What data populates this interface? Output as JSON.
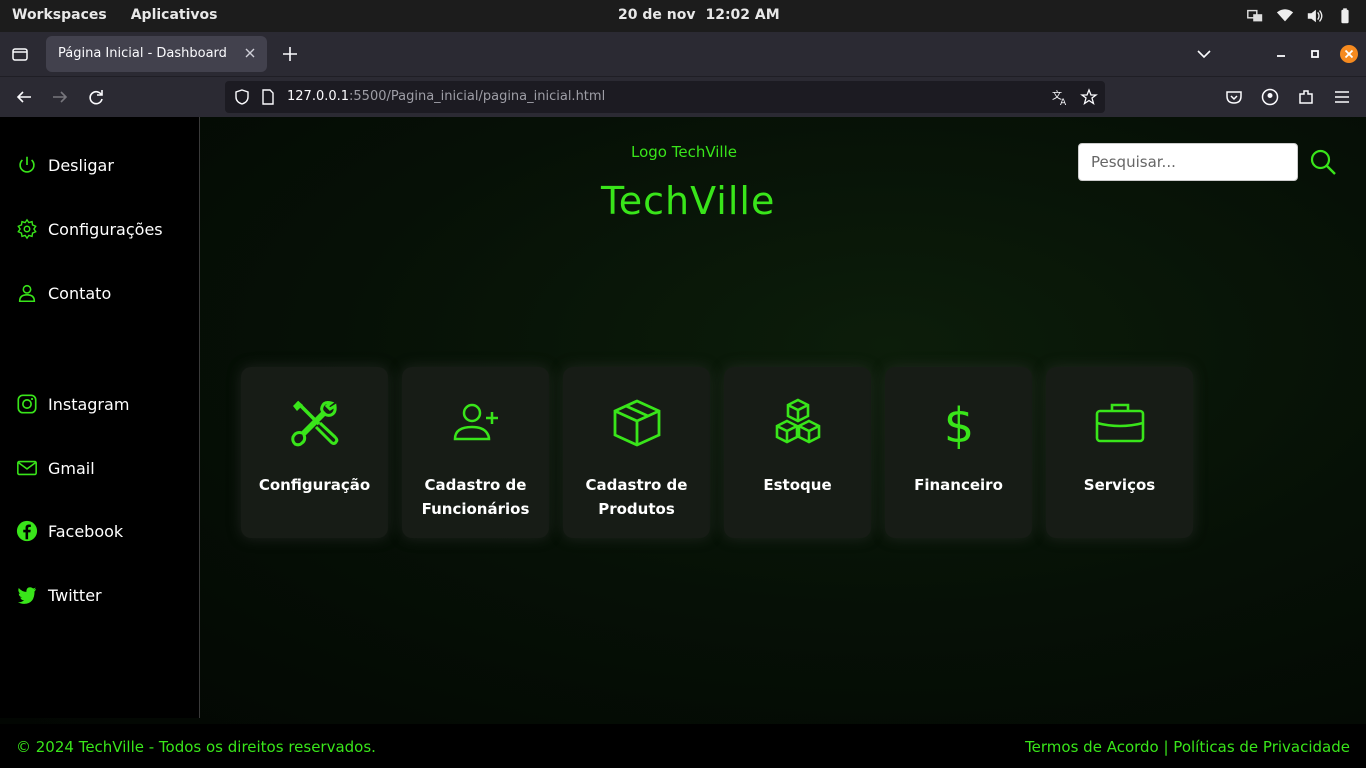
{
  "os": {
    "workspaces": "Workspaces",
    "apps": "Aplicativos",
    "date": "20 de nov",
    "time": "12:02 AM"
  },
  "browser": {
    "tab_title": "Página Inicial - Dashboard",
    "url_host": "127.0.0.1",
    "url_rest": ":5500/Pagina_inicial/pagina_inicial.html"
  },
  "sidebar": {
    "items": [
      {
        "label": "Desligar",
        "icon": "power-icon"
      },
      {
        "label": "Configurações",
        "icon": "gear-icon"
      },
      {
        "label": "Contato",
        "icon": "user-icon"
      },
      {
        "label": "Instagram",
        "icon": "instagram-icon"
      },
      {
        "label": "Gmail",
        "icon": "mail-icon"
      },
      {
        "label": "Facebook",
        "icon": "facebook-icon"
      },
      {
        "label": "Twitter",
        "icon": "twitter-icon"
      }
    ]
  },
  "header": {
    "logo_alt": "Logo TechVille",
    "brand": "TechVille",
    "search_placeholder": "Pesquisar..."
  },
  "cards": [
    {
      "label": "Configuração",
      "icon": "tools-icon"
    },
    {
      "label": "Cadastro de Funcionários",
      "icon": "add-user-icon"
    },
    {
      "label": "Cadastro de Produtos",
      "icon": "box-icon"
    },
    {
      "label": "Estoque",
      "icon": "boxes-icon"
    },
    {
      "label": "Financeiro",
      "icon": "dollar-icon"
    },
    {
      "label": "Serviços",
      "icon": "briefcase-icon"
    }
  ],
  "footer": {
    "copyright": "© 2024 TechVille - Todos os direitos reservados.",
    "links": "Termos de Acordo | Políticas de Privacidade"
  },
  "colors": {
    "accent": "#39e51a",
    "card_bg": "#171c16",
    "browser_chrome": "#2b2a33"
  }
}
